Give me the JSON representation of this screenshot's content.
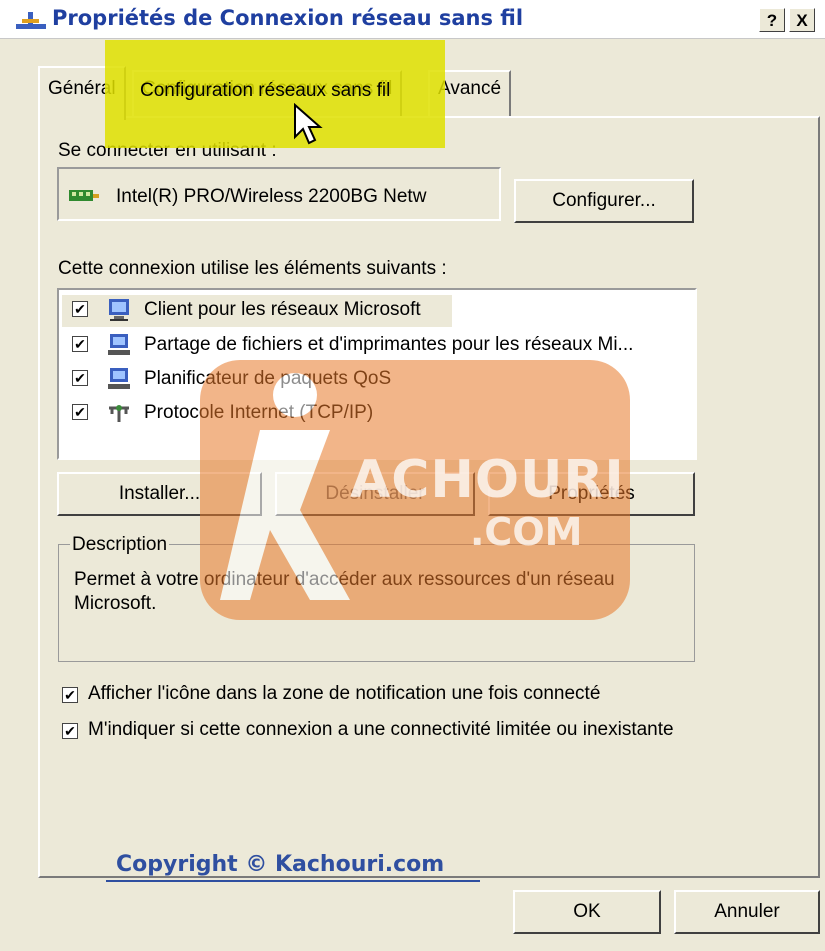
{
  "window": {
    "title": "Propriétés de Connexion réseau sans fil",
    "help_button": "?",
    "close_button": "X"
  },
  "tabs": [
    {
      "label": "Général"
    },
    {
      "label": "Configuration réseaux sans fil"
    },
    {
      "label": "Avancé"
    }
  ],
  "general": {
    "connect_using_label": "Se connecter en utilisant :",
    "adapter_name": "Intel(R) PRO/Wireless 2200BG Netw",
    "configure_button": "Configurer...",
    "components_label": "Cette connexion utilise les éléments suivants :",
    "components": [
      {
        "label": "Client pour les réseaux Microsoft",
        "checked": true,
        "icon": "client-icon"
      },
      {
        "label": "Partage de fichiers et d'imprimantes pour les réseaux Mi...",
        "checked": true,
        "icon": "file-share-icon"
      },
      {
        "label": "Planificateur de paquets QoS",
        "checked": true,
        "icon": "qos-icon"
      },
      {
        "label": "Protocole Internet (TCP/IP)",
        "checked": true,
        "icon": "protocol-icon"
      }
    ],
    "install_button": "Installer...",
    "uninstall_button": "Désinstaller",
    "properties_button": "Propriétés",
    "description_title": "Description",
    "description_text": "Permet à votre ordinateur d'accéder aux ressources d'un réseau Microsoft.",
    "show_icon_label": "Afficher l'icône dans la zone de notification une fois connecté",
    "show_icon_checked": true,
    "notify_label": "M'indiquer si cette connexion a une connectivité limitée ou inexistante",
    "notify_checked": true
  },
  "footer": {
    "ok_button": "OK",
    "cancel_button": "Annuler"
  },
  "overlay": {
    "copyright": "Copyright © Kachouri.com",
    "watermark_main": "ACHOURI",
    "watermark_sub": ".COM"
  },
  "colors": {
    "dialog_bg": "#ece9d8",
    "title_text": "#1f3fa0",
    "highlight": "#dfe000",
    "watermark": "#e8792a"
  }
}
